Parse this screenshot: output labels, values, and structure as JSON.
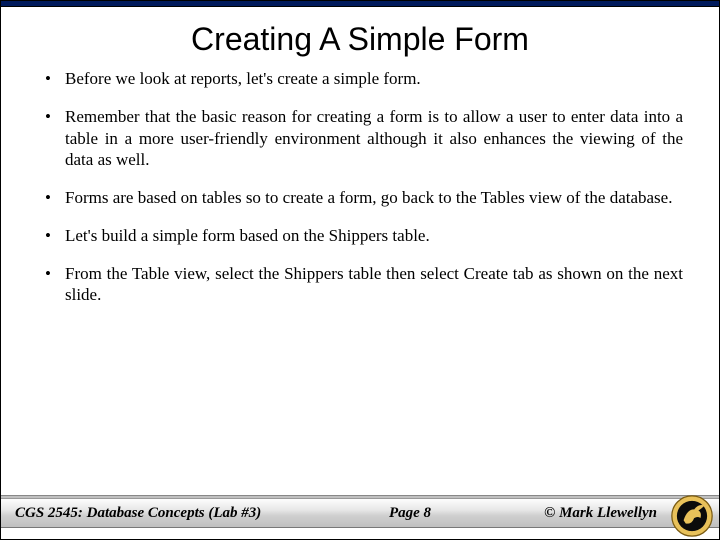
{
  "title": "Creating A Simple Form",
  "bullets": [
    "Before we look at reports, let's create a simple form.",
    "Remember that the basic reason for creating a form is to allow a user to enter data into a table in a more user-friendly environment although it also enhances the viewing of the data as well.",
    "Forms are based on tables so to create a form, go back to the Tables view of the database.",
    "Let's build a simple form based on the Shippers table.",
    "From the Table view, select the Shippers table then select Create tab as shown on the next slide."
  ],
  "footer": {
    "left": "CGS 2545: Database Concepts  (Lab #3)",
    "center": "Page 8",
    "right": "© Mark Llewellyn"
  }
}
